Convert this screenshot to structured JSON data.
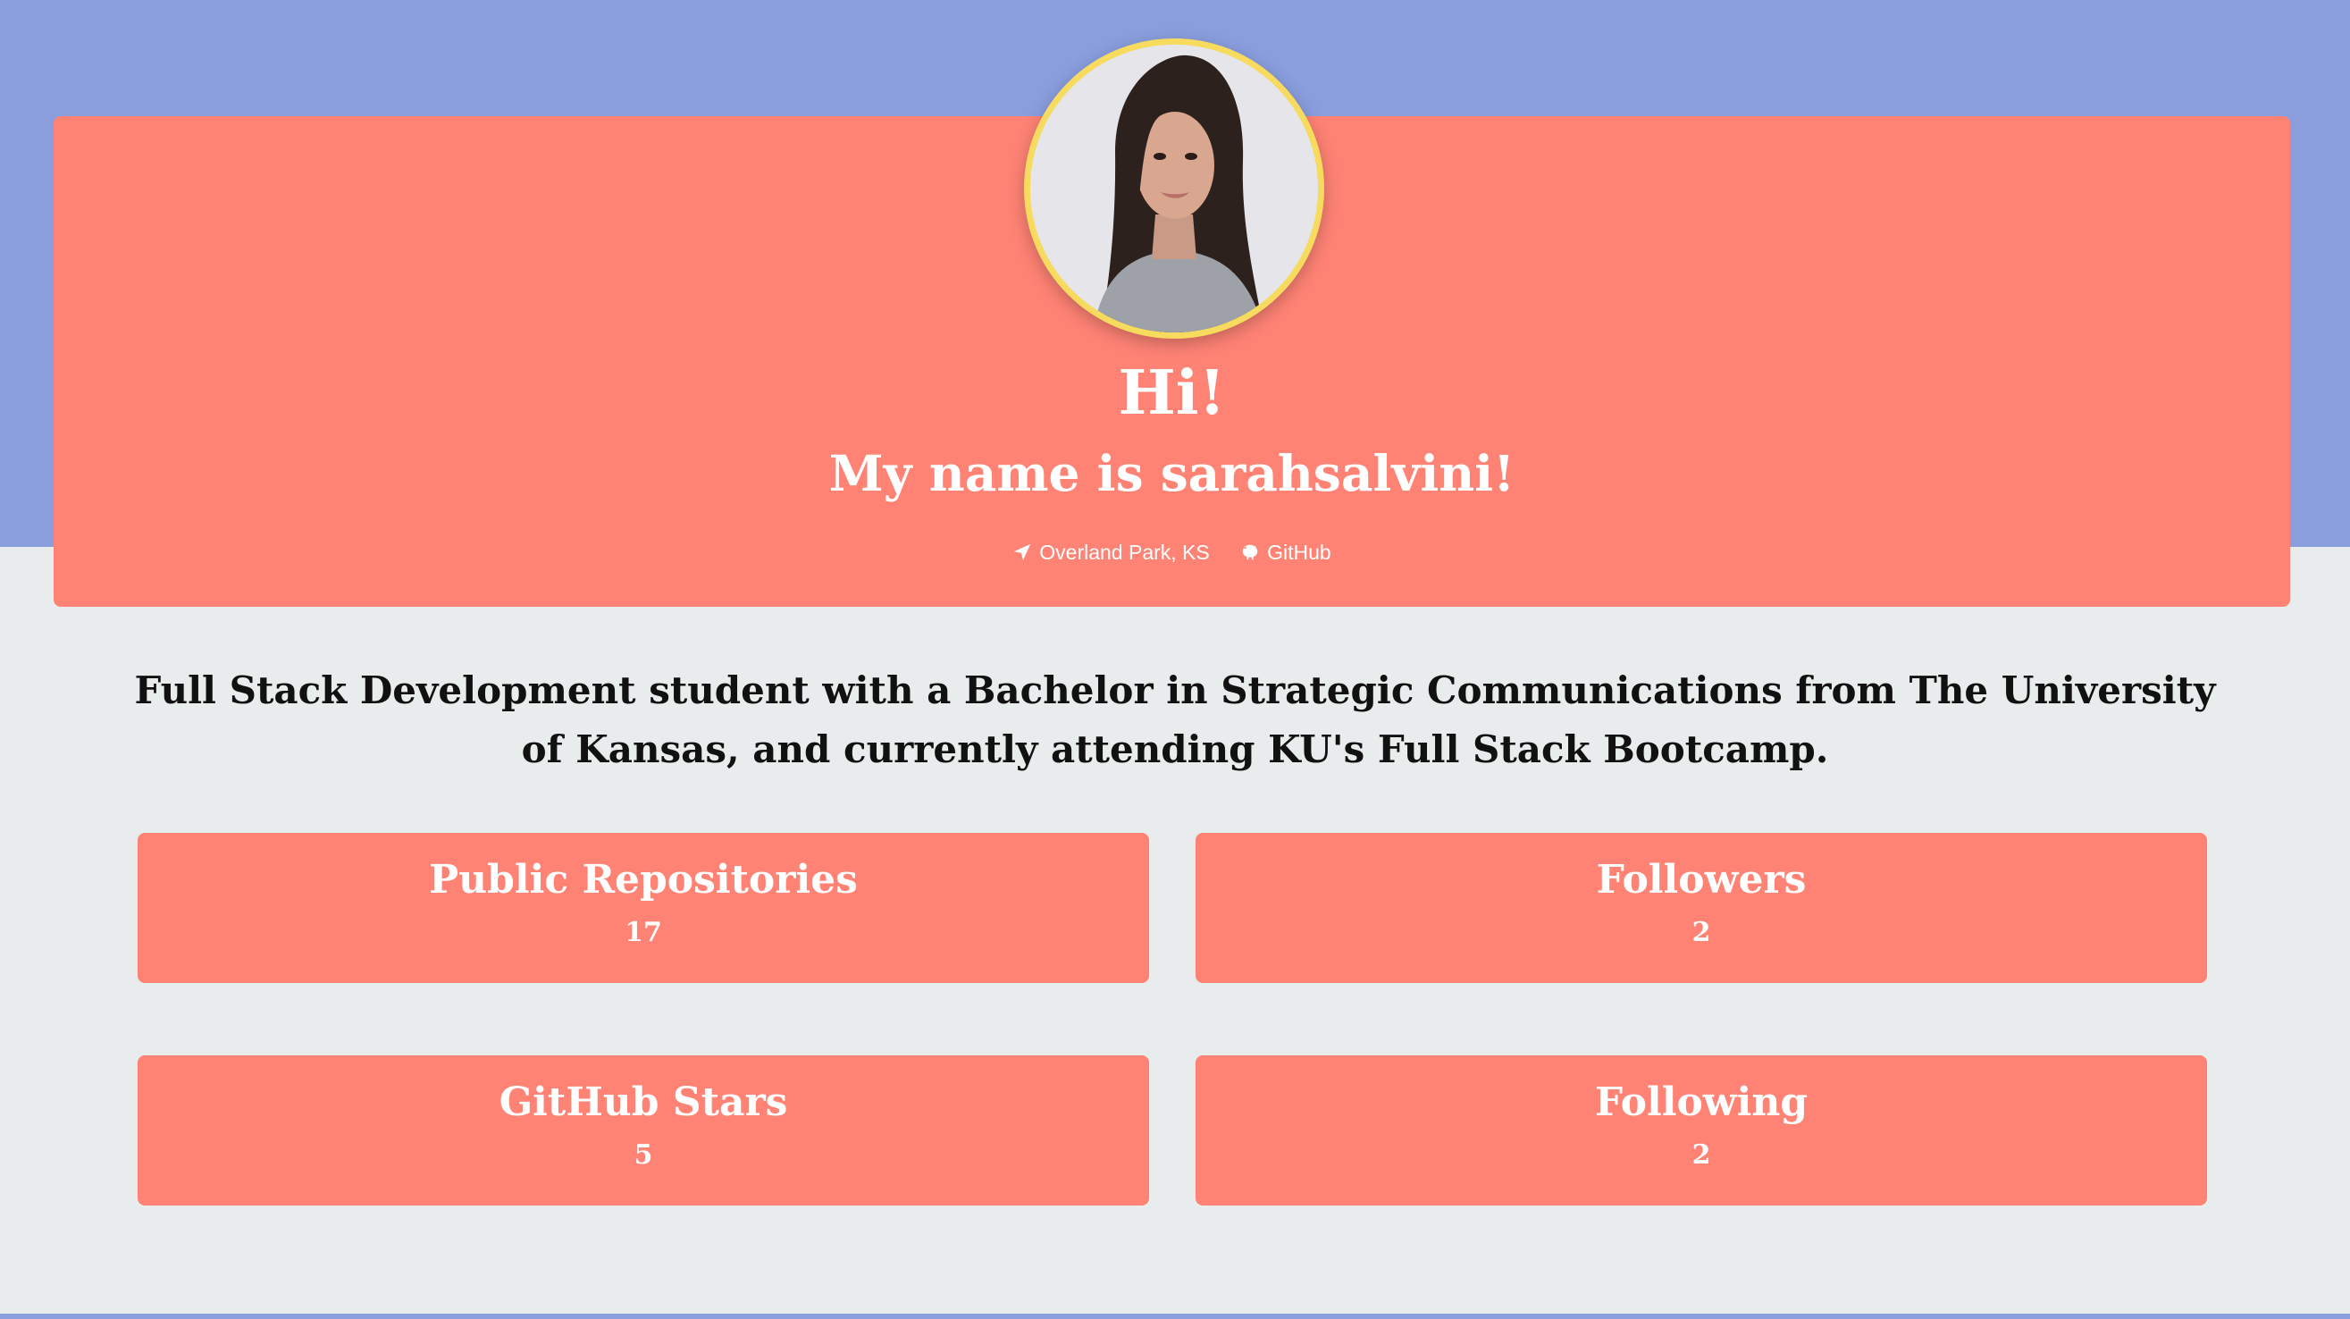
{
  "colors": {
    "band": "#8a9ede",
    "card": "#ff8375",
    "avatar_border": "#f7db5f",
    "page_background": "#e9ecec"
  },
  "profile": {
    "greeting": "Hi!",
    "intro": "My name is sarahsalvini!",
    "location": "Overland Park, KS",
    "location_icon": "location-arrow-icon",
    "github_label": "GitHub",
    "github_icon": "github-icon"
  },
  "bio": "Full Stack Development student with a Bachelor in Strategic Communications from The University of Kansas, and currently attending KU's Full Stack Bootcamp.",
  "stats": [
    {
      "label": "Public Repositories",
      "value": "17"
    },
    {
      "label": "Followers",
      "value": "2"
    },
    {
      "label": "GitHub Stars",
      "value": "5"
    },
    {
      "label": "Following",
      "value": "2"
    }
  ]
}
